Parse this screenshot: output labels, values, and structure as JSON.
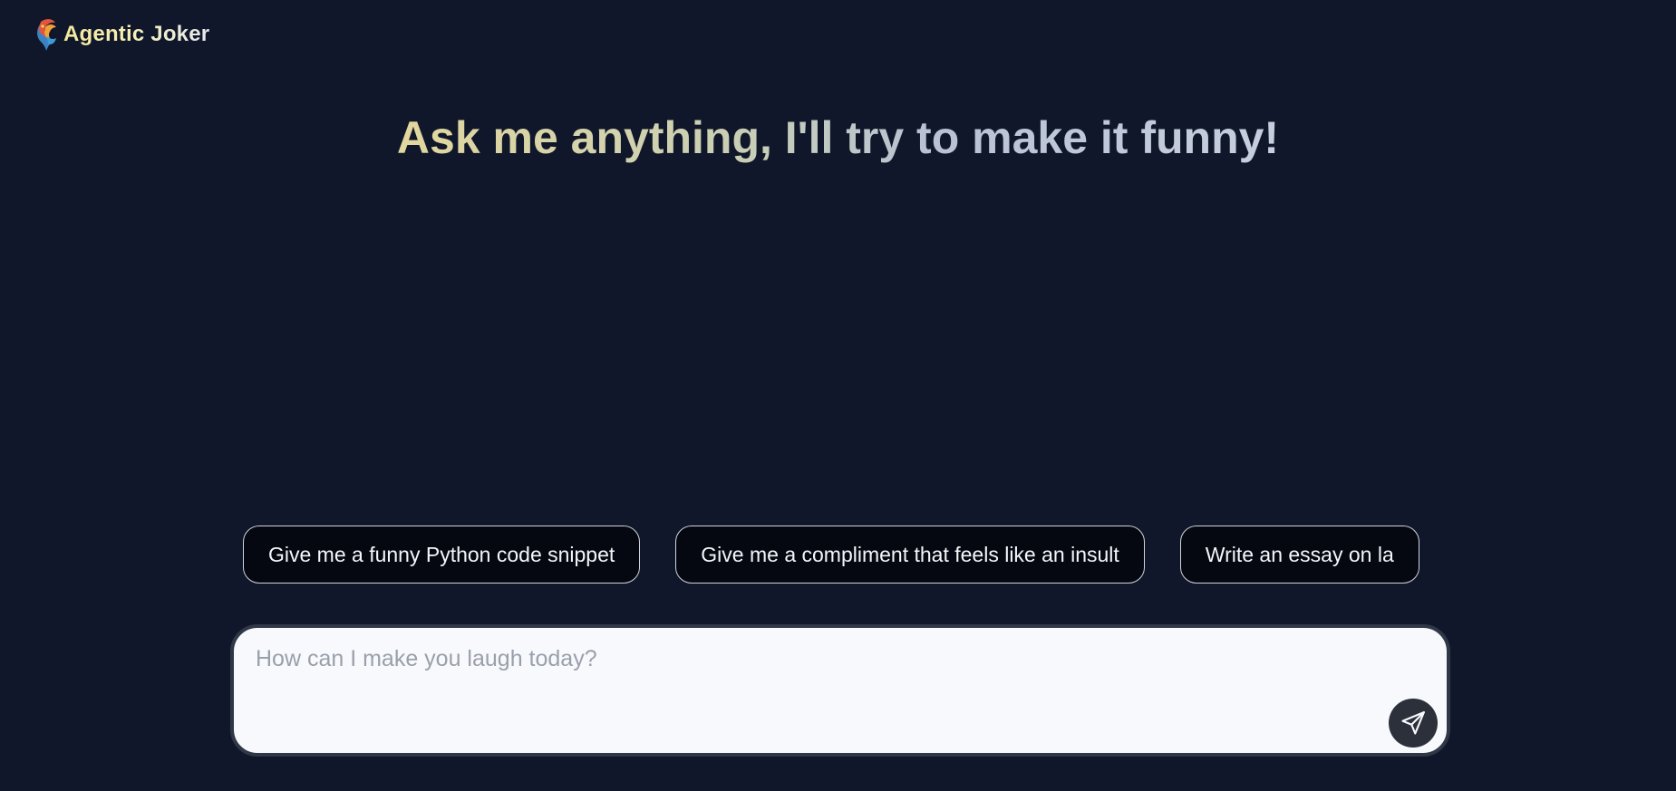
{
  "app": {
    "name": "Agentic Joker",
    "logo_icon": "joker-logo-icon"
  },
  "hero": {
    "headline": "Ask me anything, I'll try to make it funny!"
  },
  "suggestions": [
    {
      "label": "Give me a funny Python code snippet"
    },
    {
      "label": "Give me a compliment that feels like an insult"
    },
    {
      "label": "Write an essay on la"
    }
  ],
  "composer": {
    "value": "",
    "placeholder": "How can I make you laugh today?",
    "send_icon": "send-icon"
  },
  "colors": {
    "background": "#10172a",
    "chip_background": "#050811",
    "chip_border": "#cfd4dc",
    "composer_background": "#f7f9fc",
    "send_button": "#2b303b",
    "brand_yellow": "#f4ea9c"
  }
}
